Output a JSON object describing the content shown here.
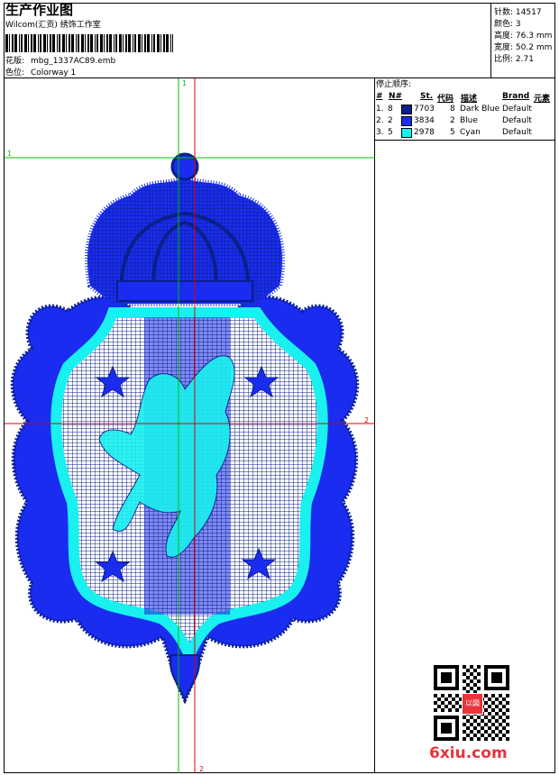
{
  "header": {
    "title": "生产作业图",
    "company": "Wilcom(汇贡) 绣饰工作室",
    "design_label": "花版:",
    "design_name": "mbg_1337AC89.emb",
    "colorway_label": "色位:",
    "colorway_name": "Colorway 1"
  },
  "stats": [
    {
      "label": "针数:",
      "value": "14517"
    },
    {
      "label": "颜色:",
      "value": "3"
    },
    {
      "label": "高度:",
      "value": "76.3 mm"
    },
    {
      "label": "宽度:",
      "value": "50.2 mm"
    },
    {
      "label": "比例:",
      "value": "2.71"
    }
  ],
  "stop_sequence": {
    "title": "停止顺序:",
    "columns": [
      "#",
      "N#",
      "St.",
      "代码",
      "描述",
      "Brand",
      "元素"
    ],
    "rows": [
      {
        "idx": "1.",
        "n": "8",
        "st": "7703",
        "code": "8",
        "desc": "Dark Blue",
        "brand": "Default",
        "color": "#0b1f8a"
      },
      {
        "idx": "2.",
        "n": "2",
        "st": "3834",
        "code": "2",
        "desc": "Blue",
        "brand": "Default",
        "color": "#1a2cf0"
      },
      {
        "idx": "3.",
        "n": "5",
        "st": "2978",
        "code": "5",
        "desc": "Cyan",
        "brand": "Default",
        "color": "#19f0f0"
      }
    ]
  },
  "crosshair_labels": {
    "top": "1",
    "left": "1",
    "right": "2",
    "bottom": "2"
  },
  "watermark": "6xiu.com",
  "qr_stamp": "以図",
  "colors": {
    "guide_green": "#00c000",
    "guide_red": "#e00000",
    "dark_blue": "#0b1f8a",
    "blue": "#1a2cf0",
    "cyan": "#19f0f0",
    "watermark_red": "#e8343b"
  }
}
